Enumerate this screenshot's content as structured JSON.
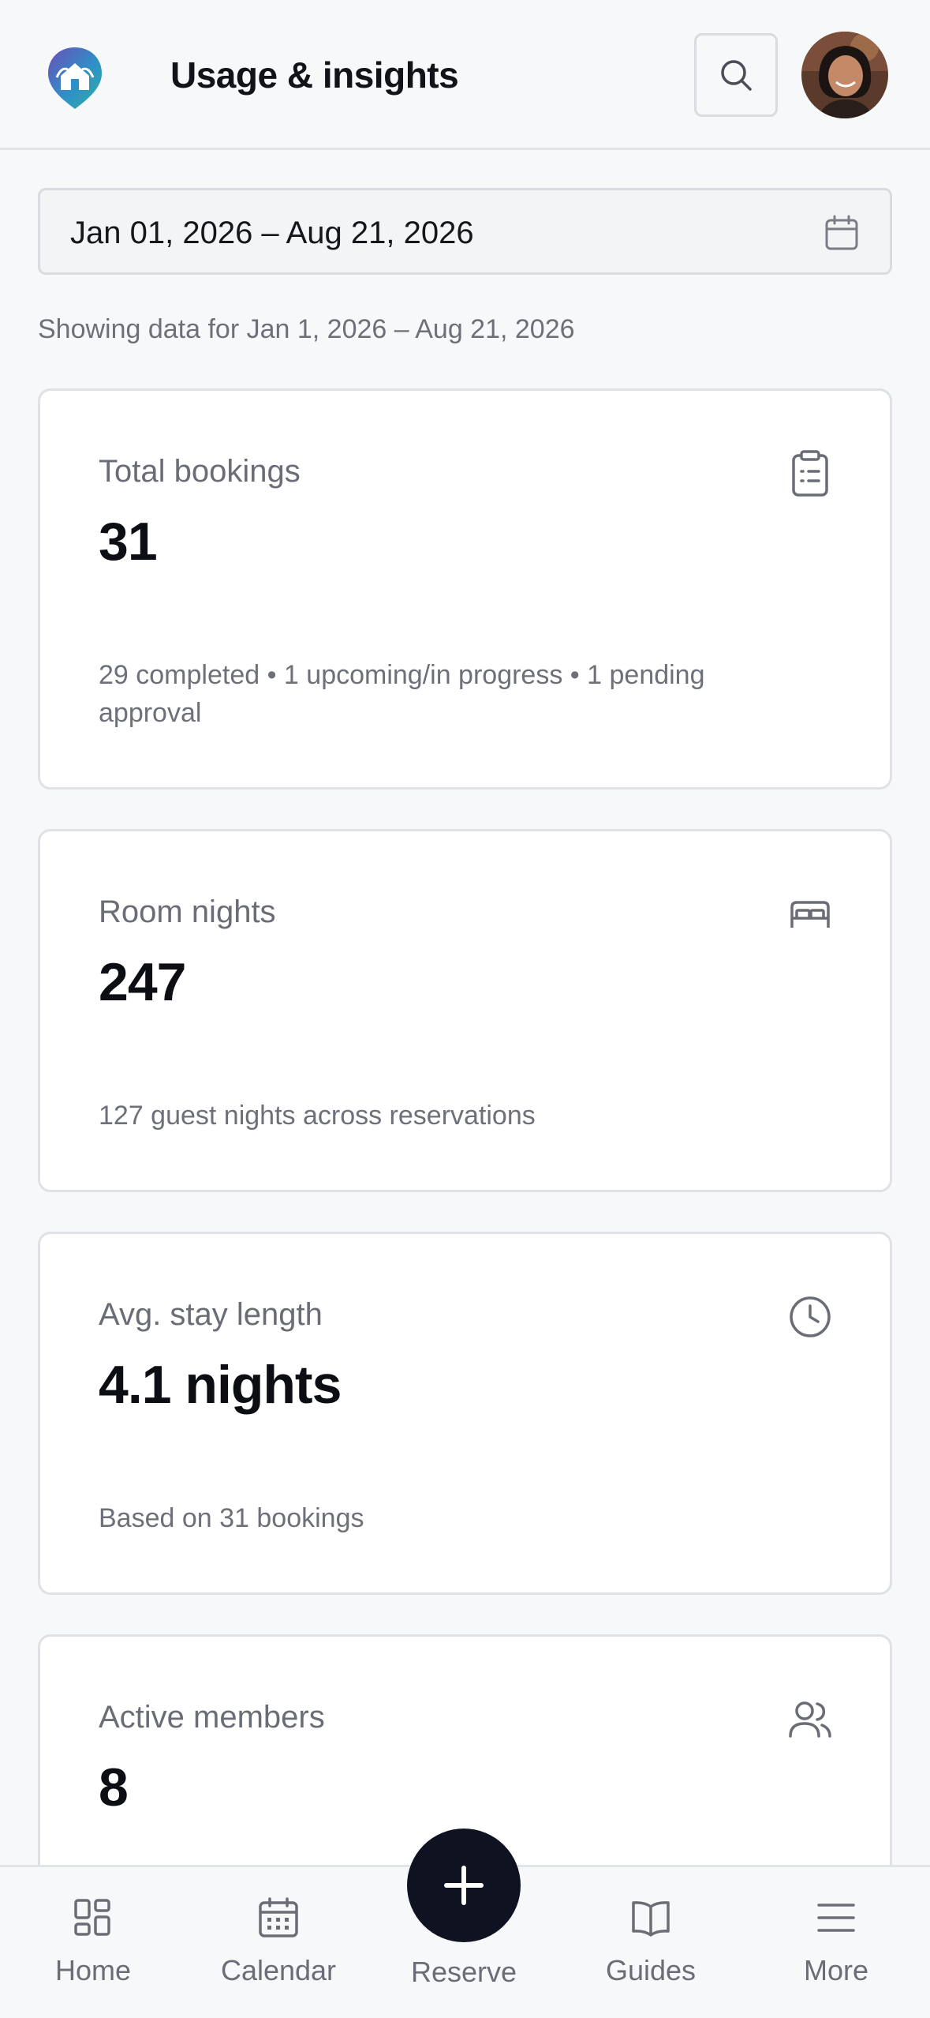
{
  "header": {
    "title": "Usage & insights",
    "search_icon": "search-icon",
    "avatar": "user-avatar"
  },
  "date_range": {
    "value": "Jan 01, 2026 – Aug 21, 2026",
    "icon": "calendar-icon"
  },
  "showing_text": "Showing data for Jan 1, 2026 – Aug 21, 2026",
  "cards": [
    {
      "label": "Total bookings",
      "value": "31",
      "sub": "29 completed • 1 upcoming/in progress • 1 pending approval",
      "icon": "clipboard-icon"
    },
    {
      "label": "Room nights",
      "value": "247",
      "sub": "127 guest nights across reservations",
      "icon": "bed-icon"
    },
    {
      "label": "Avg. stay length",
      "value": "4.1 nights",
      "sub": "Based on 31 bookings",
      "icon": "clock-icon"
    },
    {
      "label": "Active members",
      "value": "8",
      "sub": "",
      "icon": "users-icon"
    }
  ],
  "nav": {
    "home": "Home",
    "calendar": "Calendar",
    "reserve": "Reserve",
    "guides": "Guides",
    "more": "More"
  },
  "colors": {
    "accent_dark": "#0f1220",
    "logo_teal": "#2bb3a3",
    "logo_purple": "#6a4fb8"
  }
}
